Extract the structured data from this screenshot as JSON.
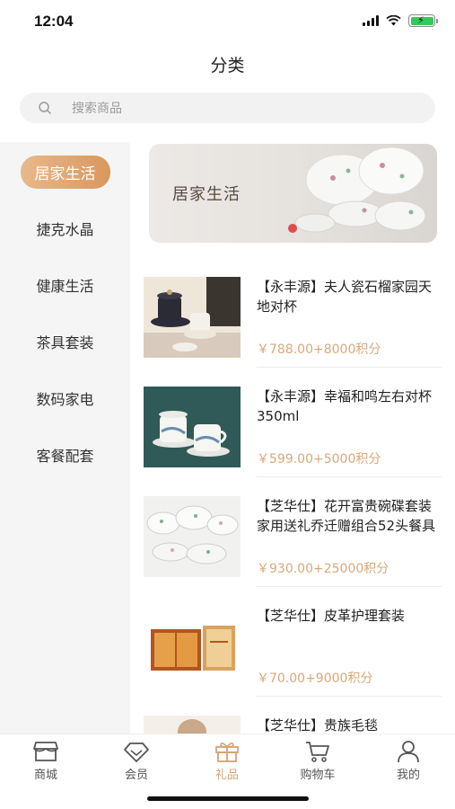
{
  "status": {
    "time": "12:04"
  },
  "header": {
    "title": "分类"
  },
  "search": {
    "placeholder": "搜索商品"
  },
  "sidebar": {
    "items": [
      {
        "label": "居家生活",
        "active": true
      },
      {
        "label": "捷克水晶"
      },
      {
        "label": "健康生活"
      },
      {
        "label": "茶具套装"
      },
      {
        "label": "数码家电"
      },
      {
        "label": "客餐配套"
      }
    ]
  },
  "banner": {
    "title": "居家生活"
  },
  "products": [
    {
      "name": "【永丰源】夫人瓷石榴家园天地对杯",
      "price": "￥788.00+8000积分",
      "image_icon": "tea-cup-set-image"
    },
    {
      "name": "【永丰源】幸福和鸣左右对杯350ml",
      "price": "￥599.00+5000积分",
      "image_icon": "mug-pair-image"
    },
    {
      "name": "【芝华仕】花开富贵碗碟套装家用送礼乔迁赠组合52头餐具",
      "price": "￥930.00+25000积分",
      "image_icon": "dinnerware-set-image"
    },
    {
      "name": "【芝华仕】皮革护理套装",
      "price": "￥70.00+9000积分",
      "image_icon": "leather-care-kit-image"
    },
    {
      "name": "【芝华仕】贵族毛毯",
      "price": "",
      "image_icon": "blanket-image"
    }
  ],
  "tabbar": {
    "items": [
      {
        "label": "商城",
        "icon": "shop-icon"
      },
      {
        "label": "会员",
        "icon": "diamond-icon"
      },
      {
        "label": "礼品",
        "icon": "gift-icon",
        "active": true
      },
      {
        "label": "购物车",
        "icon": "cart-icon"
      },
      {
        "label": "我的",
        "icon": "profile-icon"
      }
    ]
  },
  "colors": {
    "accent": "#d4a373",
    "price": "#d9a97a",
    "sidebar_bg": "#f5f5f5"
  }
}
